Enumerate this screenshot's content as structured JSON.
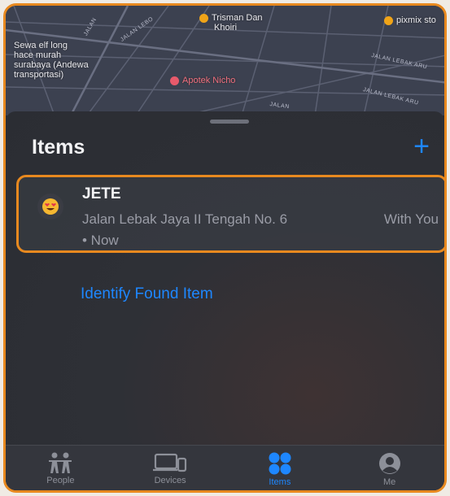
{
  "map": {
    "poi_top_left_1": "Trisman Dan",
    "poi_top_left_2": "Khoiri",
    "poi_top_right": "pixmix sto",
    "place_left": [
      "Sewa elf long",
      "hace murah",
      "surabaya (Andewa",
      "transportasi)"
    ],
    "poi_pharmacy": "Apotek Nicho",
    "streets": [
      "JALAN LEBO",
      "JALAN",
      "JALAN LEBAK ARU",
      "JALAN LEBAK ARU",
      "JALAN"
    ]
  },
  "sheet": {
    "title": "Items",
    "add_label": "+"
  },
  "item": {
    "emoji": "😍",
    "name": "JETE",
    "address": "Jalan Lebak Jaya II Tengah No. 6",
    "time": "• Now",
    "status": "With You"
  },
  "identify_link": "Identify Found Item",
  "tabs": [
    {
      "label": "People",
      "icon": "people-icon",
      "active": false
    },
    {
      "label": "Devices",
      "icon": "devices-icon",
      "active": false
    },
    {
      "label": "Items",
      "icon": "items-icon",
      "active": true
    },
    {
      "label": "Me",
      "icon": "person-circle-icon",
      "active": false
    }
  ],
  "colors": {
    "accent": "#1e87ff",
    "highlight_border": "#e8891f",
    "background": "#2b2d33"
  }
}
